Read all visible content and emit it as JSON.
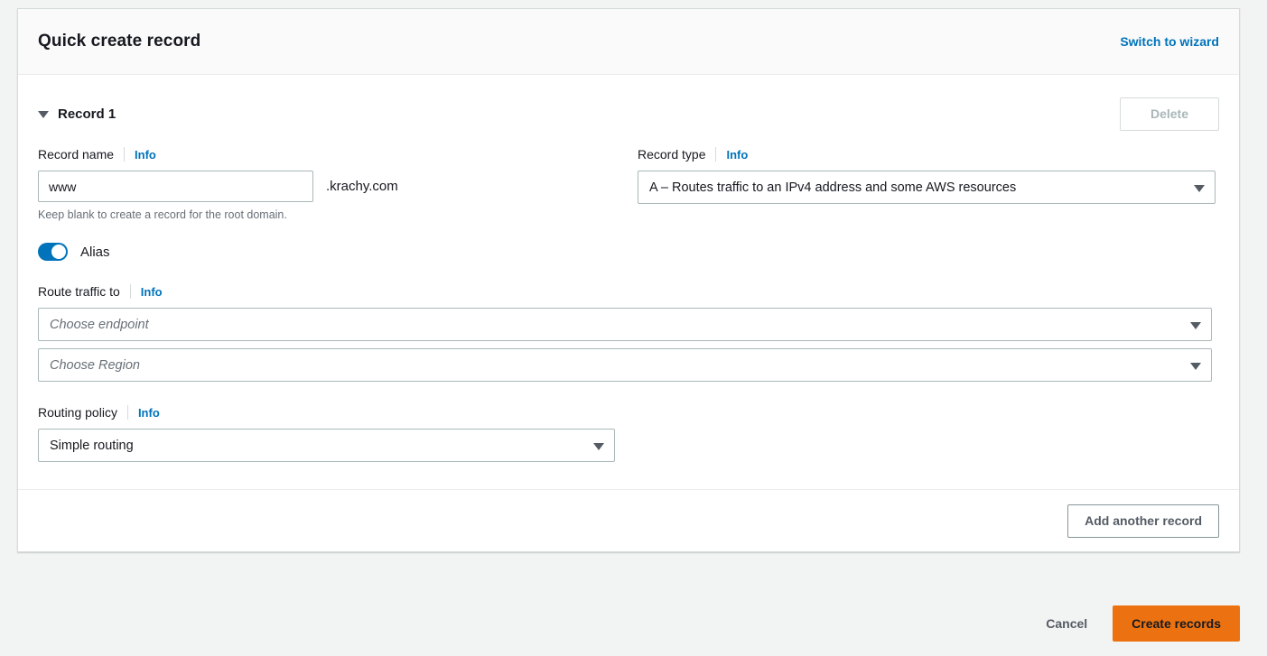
{
  "card": {
    "title": "Quick create record",
    "switch_link": "Switch to wizard"
  },
  "record": {
    "header_label": "Record 1",
    "delete_label": "Delete",
    "record_name": {
      "label": "Record name",
      "info": "Info",
      "value": "www",
      "placeholder": "",
      "domain_suffix": ".krachy.com",
      "helper": "Keep blank to create a record for the root domain."
    },
    "record_type": {
      "label": "Record type",
      "info": "Info",
      "value": "A – Routes traffic to an IPv4 address and some AWS resources"
    },
    "alias": {
      "label": "Alias",
      "enabled": true
    },
    "route_traffic": {
      "label": "Route traffic to",
      "info": "Info",
      "endpoint_placeholder": "Choose endpoint",
      "region_placeholder": "Choose Region"
    },
    "routing_policy": {
      "label": "Routing policy",
      "info": "Info",
      "value": "Simple routing"
    }
  },
  "footer": {
    "add_record_label": "Add another record",
    "cancel_label": "Cancel",
    "create_label": "Create records"
  },
  "colors": {
    "link": "#0073bb",
    "primary": "#ec7211",
    "page_bg": "#f2f3f3",
    "border": "#d5dbdb",
    "text": "#16191f",
    "muted": "#687078",
    "disabled": "#aab7b8"
  }
}
